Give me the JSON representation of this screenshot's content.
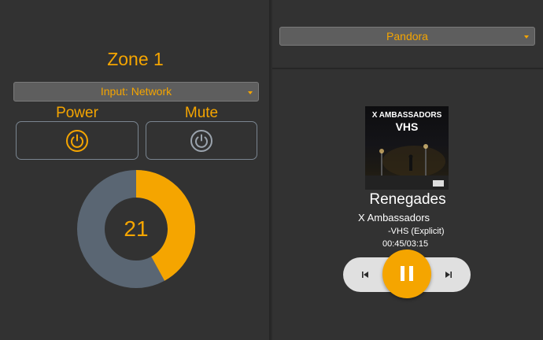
{
  "zone": {
    "title": "Zone 1",
    "input_label": "Input: Network",
    "power_label": "Power",
    "mute_label": "Mute",
    "volume": 21,
    "volume_max": 50,
    "colors": {
      "accent": "#f5a500",
      "track": "#5a6673",
      "mute_icon": "#9aa3ad"
    }
  },
  "source": {
    "selected": "Pandora"
  },
  "now_playing": {
    "album_art": {
      "band": "X AMBASSADORS",
      "album": "VHS"
    },
    "song": "Renegades",
    "artist": "X Ambassadors",
    "album": "-VHS (Explicit)",
    "time": "00:45/03:15"
  },
  "controls": {
    "state": "playing",
    "icons": [
      "previous-icon",
      "pause-icon",
      "next-icon"
    ]
  }
}
